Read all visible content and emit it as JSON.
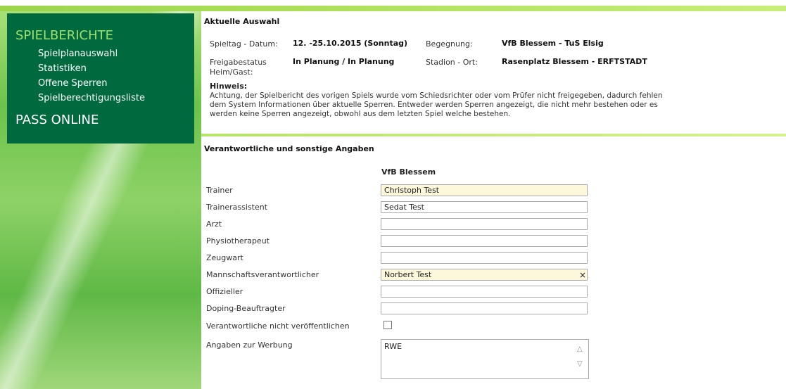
{
  "nav": {
    "heading1": "SPIELBERICHTE",
    "items": [
      "Spielplanauswahl",
      "Statistiken",
      "Offene Sperren",
      "Spielberechtigungsliste"
    ],
    "heading2": "PASS ONLINE"
  },
  "current": {
    "title": "Aktuelle Auswahl",
    "spieltag_label": "Spieltag - Datum:",
    "spieltag_value": "12. -25.10.2015 (Sonntag)",
    "begegnung_label": "Begegnung:",
    "begegnung_value": "VfB Blessem - TuS Elsig",
    "freigabe_label_line1": "Freigabestatus",
    "freigabe_label_line2": "Heim/Gast:",
    "freigabe_value": "In Planung / In Planung",
    "stadion_label": "Stadion - Ort:",
    "stadion_value": "Rasenplatz Blessem - ERFTSTADT",
    "hint_title": "Hinweis:",
    "hint_text": "Achtung, der Spielbericht des vorigen Spiels wurde vom Schiedsrichter oder vom Prüfer nicht freigegeben, dadurch fehlen dem System Informationen über aktuelle Sperren. Entweder werden Sperren angezeigt, die nicht mehr bestehen oder es werden keine Sperren angezeigt, obwohl aus dem letzten Spiel welche bestehen."
  },
  "form": {
    "title": "Verantwortliche und sonstige Angaben",
    "team": "VfB Blessem",
    "rows": [
      {
        "label": "Trainer",
        "value": "Christoph Test"
      },
      {
        "label": "Trainerassistent",
        "value": "Sedat Test"
      },
      {
        "label": "Arzt",
        "value": ""
      },
      {
        "label": "Physiotherapeut",
        "value": ""
      },
      {
        "label": "Zeugwart",
        "value": ""
      },
      {
        "label": "Mannschaftsverantwortlicher",
        "value": "Norbert Test"
      },
      {
        "label": "Offizieller",
        "value": ""
      },
      {
        "label": "Doping-Beauftragter",
        "value": ""
      }
    ],
    "hide_label": "Verantwortliche nicht veröffentlichen",
    "advert_label": "Angaben zur Werbung",
    "advert_value": "RWE",
    "clear_glyph": "×"
  }
}
